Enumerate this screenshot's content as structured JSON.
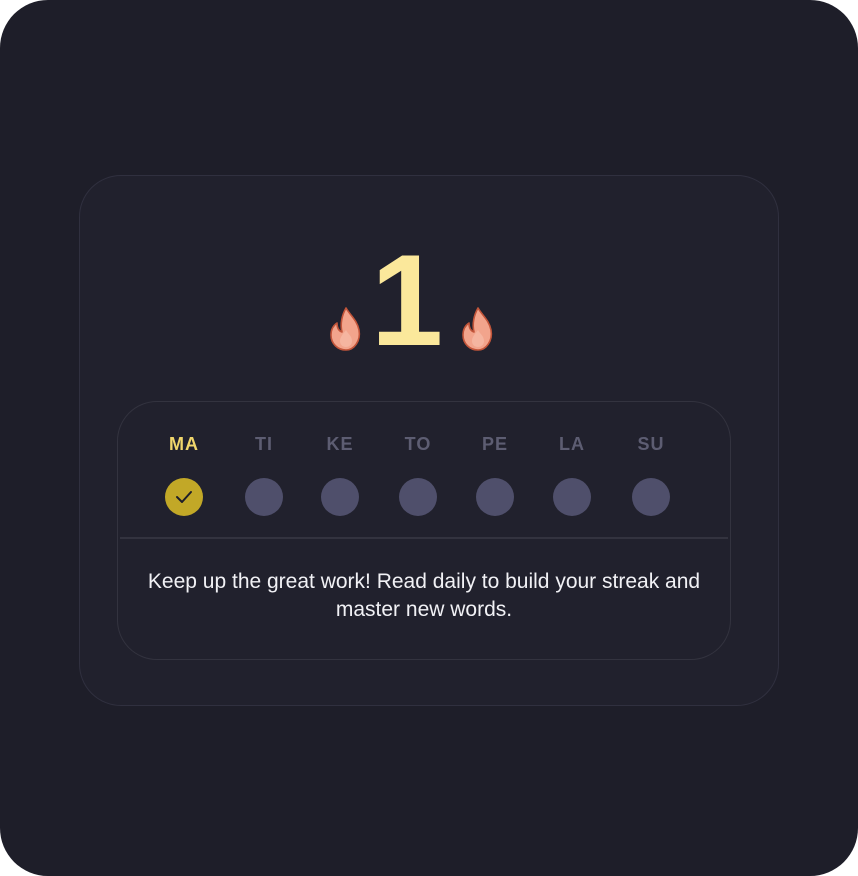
{
  "streak": {
    "count": "1",
    "flame_icon": "flame-icon",
    "number_color": "#fbe89b",
    "flame_color": "#f2a48c"
  },
  "week": {
    "days": [
      {
        "label": "MA",
        "completed": true,
        "current": true
      },
      {
        "label": "TI",
        "completed": false,
        "current": false
      },
      {
        "label": "KE",
        "completed": false,
        "current": false
      },
      {
        "label": "TO",
        "completed": false,
        "current": false
      },
      {
        "label": "PE",
        "completed": false,
        "current": false
      },
      {
        "label": "LA",
        "completed": false,
        "current": false
      },
      {
        "label": "SU",
        "completed": false,
        "current": false
      }
    ],
    "check_icon": "check-icon",
    "active_color": "#c2a827",
    "inactive_color": "#4f4f6b"
  },
  "message": {
    "text": "Keep up the great work! Read daily to build your streak and master new words."
  }
}
